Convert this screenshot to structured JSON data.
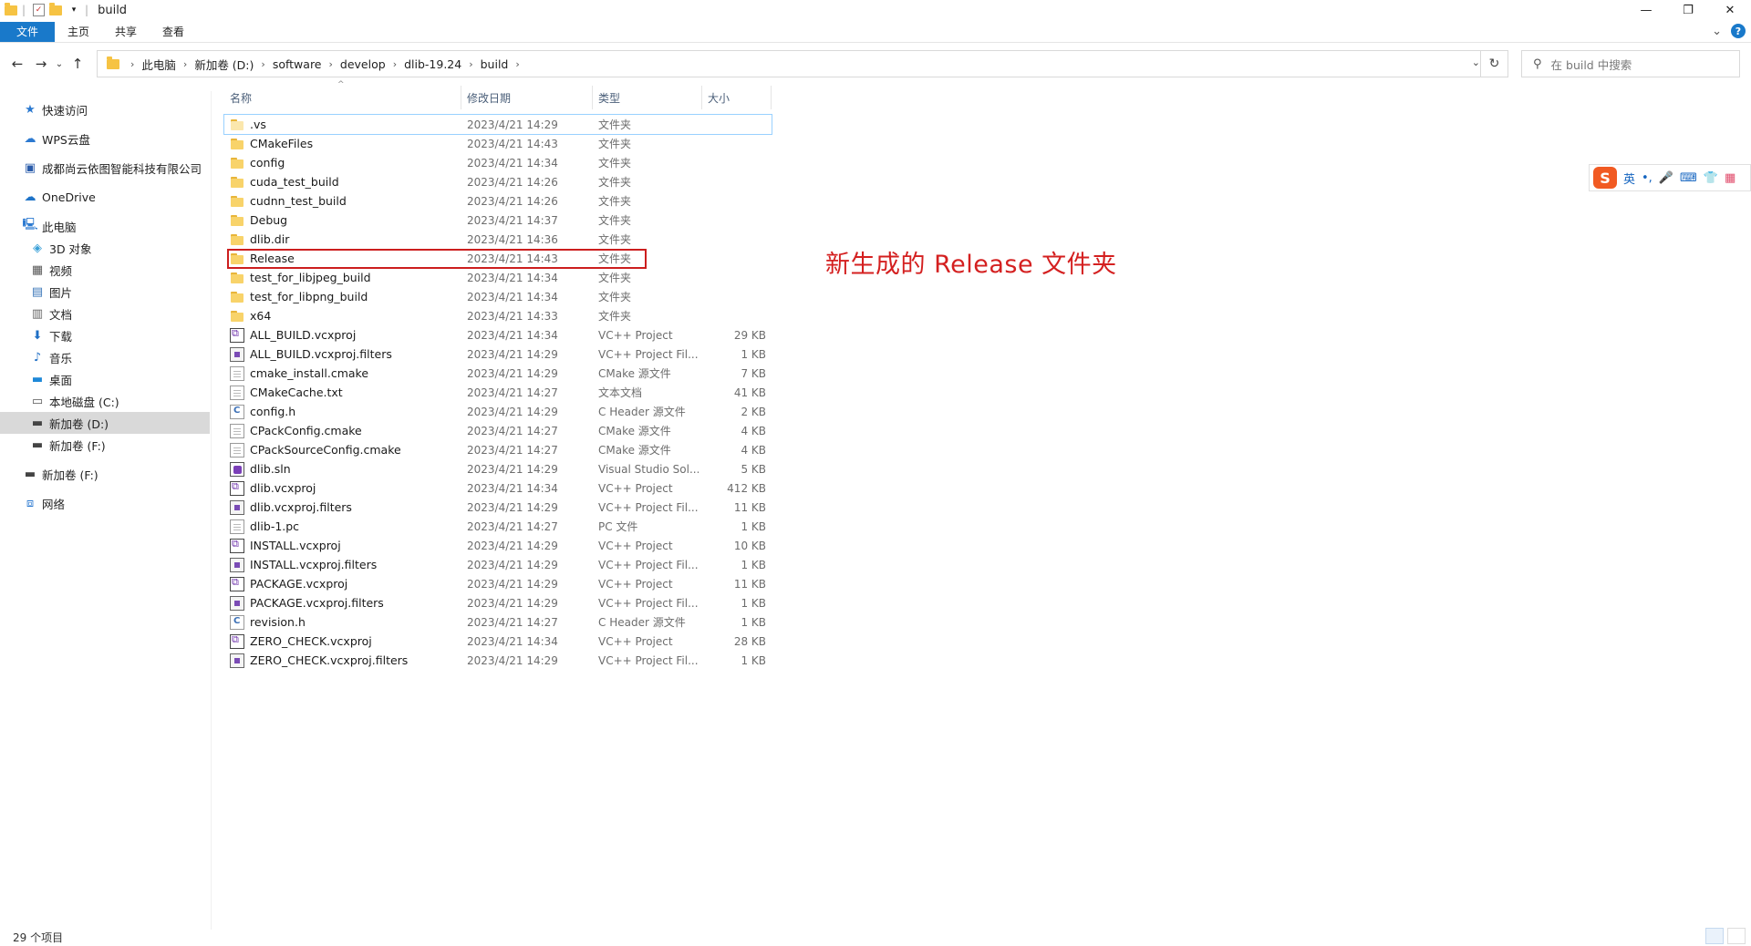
{
  "window": {
    "title": "build",
    "controls": [
      "—",
      "❐",
      "✕"
    ]
  },
  "ribbon": {
    "tabs": [
      "文件",
      "主页",
      "共享",
      "查看"
    ],
    "expand_glyph": "⌄",
    "help_glyph": "?"
  },
  "nav": {
    "back": "←",
    "forward": "→",
    "recent": "⌄",
    "up": "↑",
    "breadcrumb": [
      "此电脑",
      "新加卷 (D:)",
      "software",
      "develop",
      "dlib-19.24",
      "build"
    ],
    "search_placeholder": "在 build 中搜索"
  },
  "sidebar": {
    "items": [
      {
        "label": "快速访问",
        "icon": "star-icon",
        "glyph": "★",
        "color": "#2b79d0"
      },
      {
        "label": "WPS云盘",
        "icon": "cloud-icon",
        "glyph": "☁",
        "color": "#2b79d0"
      },
      {
        "label": "成都尚云依图智能科技有限公司",
        "icon": "building-icon",
        "glyph": "▣",
        "color": "#2a5caa"
      },
      {
        "label": "OneDrive",
        "icon": "onedrive-icon",
        "glyph": "☁",
        "color": "#1e73c8"
      },
      {
        "label": "此电脑",
        "icon": "computer-icon",
        "glyph": "🖳",
        "color": "#2b79d0"
      },
      {
        "label": "3D 对象",
        "icon": "cube-icon",
        "glyph": "◈",
        "color": "#3aa0d8"
      },
      {
        "label": "视频",
        "icon": "video-icon",
        "glyph": "▦",
        "color": "#555"
      },
      {
        "label": "图片",
        "icon": "picture-icon",
        "glyph": "▤",
        "color": "#3a76b8"
      },
      {
        "label": "文档",
        "icon": "document-icon",
        "glyph": "▥",
        "color": "#666"
      },
      {
        "label": "下载",
        "icon": "download-icon",
        "glyph": "⬇",
        "color": "#1f6fc5"
      },
      {
        "label": "音乐",
        "icon": "music-icon",
        "glyph": "♪",
        "color": "#1f6fc5"
      },
      {
        "label": "桌面",
        "icon": "desktop-icon",
        "glyph": "▬",
        "color": "#1e88d8"
      },
      {
        "label": "本地磁盘 (C:)",
        "icon": "drive-c-icon",
        "glyph": "▭",
        "color": "#555"
      },
      {
        "label": "新加卷 (D:)",
        "icon": "drive-d-icon",
        "glyph": "▬",
        "color": "#444"
      },
      {
        "label": "新加卷 (F:)",
        "icon": "drive-f-icon",
        "glyph": "▬",
        "color": "#444"
      },
      {
        "label": "新加卷 (F:)",
        "icon": "drive-f-icon",
        "glyph": "▬",
        "color": "#444"
      },
      {
        "label": "网络",
        "icon": "network-icon",
        "glyph": "⧈",
        "color": "#2b79d0"
      }
    ],
    "selected_index": 13
  },
  "columns": {
    "name": "名称",
    "date": "修改日期",
    "type": "类型",
    "size": "大小",
    "sort_caret": "^"
  },
  "files": [
    {
      "name": ".vs",
      "date": "2023/4/21 14:29",
      "type": "文件夹",
      "size": "",
      "icon": "folder-empty"
    },
    {
      "name": "CMakeFiles",
      "date": "2023/4/21 14:43",
      "type": "文件夹",
      "size": "",
      "icon": "folder"
    },
    {
      "name": "config",
      "date": "2023/4/21 14:34",
      "type": "文件夹",
      "size": "",
      "icon": "folder"
    },
    {
      "name": "cuda_test_build",
      "date": "2023/4/21 14:26",
      "type": "文件夹",
      "size": "",
      "icon": "folder"
    },
    {
      "name": "cudnn_test_build",
      "date": "2023/4/21 14:26",
      "type": "文件夹",
      "size": "",
      "icon": "folder"
    },
    {
      "name": "Debug",
      "date": "2023/4/21 14:37",
      "type": "文件夹",
      "size": "",
      "icon": "folder"
    },
    {
      "name": "dlib.dir",
      "date": "2023/4/21 14:36",
      "type": "文件夹",
      "size": "",
      "icon": "folder"
    },
    {
      "name": "Release",
      "date": "2023/4/21 14:43",
      "type": "文件夹",
      "size": "",
      "icon": "folder"
    },
    {
      "name": "test_for_libjpeg_build",
      "date": "2023/4/21 14:34",
      "type": "文件夹",
      "size": "",
      "icon": "folder"
    },
    {
      "name": "test_for_libpng_build",
      "date": "2023/4/21 14:34",
      "type": "文件夹",
      "size": "",
      "icon": "folder"
    },
    {
      "name": "x64",
      "date": "2023/4/21 14:33",
      "type": "文件夹",
      "size": "",
      "icon": "folder"
    },
    {
      "name": "ALL_BUILD.vcxproj",
      "date": "2023/4/21 14:34",
      "type": "VC++ Project",
      "size": "29 KB",
      "icon": "vcx"
    },
    {
      "name": "ALL_BUILD.vcxproj.filters",
      "date": "2023/4/21 14:29",
      "type": "VC++ Project Fil...",
      "size": "1 KB",
      "icon": "filters"
    },
    {
      "name": "cmake_install.cmake",
      "date": "2023/4/21 14:29",
      "type": "CMake 源文件",
      "size": "7 KB",
      "icon": "doc"
    },
    {
      "name": "CMakeCache.txt",
      "date": "2023/4/21 14:27",
      "type": "文本文档",
      "size": "41 KB",
      "icon": "doc"
    },
    {
      "name": "config.h",
      "date": "2023/4/21 14:29",
      "type": "C Header 源文件",
      "size": "2 KB",
      "icon": "cfile"
    },
    {
      "name": "CPackConfig.cmake",
      "date": "2023/4/21 14:27",
      "type": "CMake 源文件",
      "size": "4 KB",
      "icon": "doc"
    },
    {
      "name": "CPackSourceConfig.cmake",
      "date": "2023/4/21 14:27",
      "type": "CMake 源文件",
      "size": "4 KB",
      "icon": "doc"
    },
    {
      "name": "dlib.sln",
      "date": "2023/4/21 14:29",
      "type": "Visual Studio Sol...",
      "size": "5 KB",
      "icon": "sln"
    },
    {
      "name": "dlib.vcxproj",
      "date": "2023/4/21 14:34",
      "type": "VC++ Project",
      "size": "412 KB",
      "icon": "vcx"
    },
    {
      "name": "dlib.vcxproj.filters",
      "date": "2023/4/21 14:29",
      "type": "VC++ Project Fil...",
      "size": "11 KB",
      "icon": "filters"
    },
    {
      "name": "dlib-1.pc",
      "date": "2023/4/21 14:27",
      "type": "PC 文件",
      "size": "1 KB",
      "icon": "doc"
    },
    {
      "name": "INSTALL.vcxproj",
      "date": "2023/4/21 14:29",
      "type": "VC++ Project",
      "size": "10 KB",
      "icon": "vcx"
    },
    {
      "name": "INSTALL.vcxproj.filters",
      "date": "2023/4/21 14:29",
      "type": "VC++ Project Fil...",
      "size": "1 KB",
      "icon": "filters"
    },
    {
      "name": "PACKAGE.vcxproj",
      "date": "2023/4/21 14:29",
      "type": "VC++ Project",
      "size": "11 KB",
      "icon": "vcx"
    },
    {
      "name": "PACKAGE.vcxproj.filters",
      "date": "2023/4/21 14:29",
      "type": "VC++ Project Fil...",
      "size": "1 KB",
      "icon": "filters"
    },
    {
      "name": "revision.h",
      "date": "2023/4/21 14:27",
      "type": "C Header 源文件",
      "size": "1 KB",
      "icon": "cfile"
    },
    {
      "name": "ZERO_CHECK.vcxproj",
      "date": "2023/4/21 14:34",
      "type": "VC++ Project",
      "size": "28 KB",
      "icon": "vcx"
    },
    {
      "name": "ZERO_CHECK.vcxproj.filters",
      "date": "2023/4/21 14:29",
      "type": "VC++ Project Fil...",
      "size": "1 KB",
      "icon": "filters"
    }
  ],
  "annotation": {
    "text": "新生成的 Release 文件夹",
    "color": "#d42020"
  },
  "ime": {
    "logo": "S",
    "items": [
      "英",
      "•,",
      "🎤",
      "⌨",
      "👕",
      "▦"
    ]
  },
  "status": {
    "count": "29 个项目"
  },
  "colors": {
    "accent": "#1979ca",
    "highlight_border": "#cc1e1e",
    "selected_bg": "#d9d9d9"
  }
}
